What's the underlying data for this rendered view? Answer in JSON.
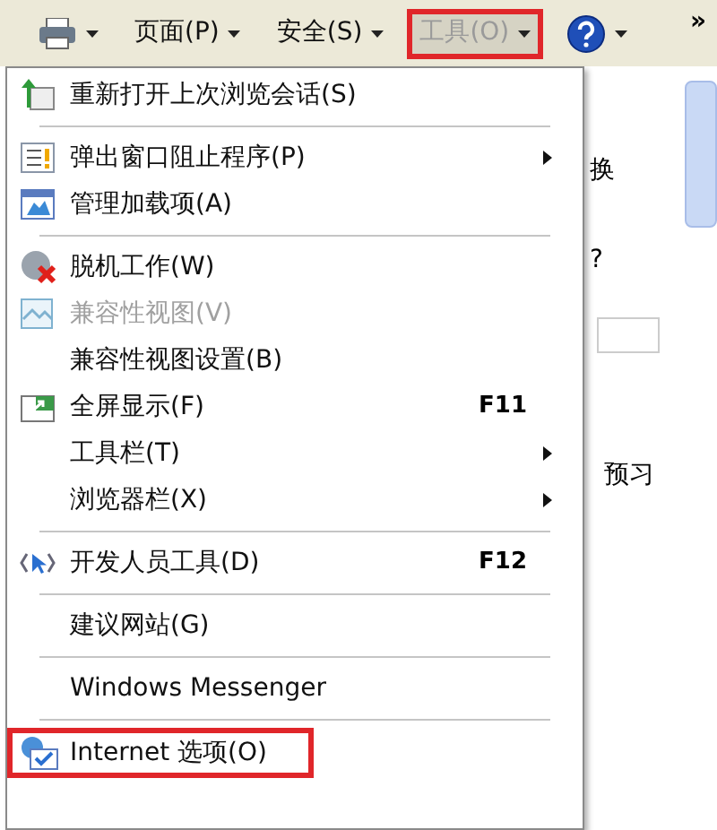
{
  "toolbar": {
    "items": [
      {
        "kind": "icon",
        "dropdown": true,
        "selected": false
      },
      {
        "kind": "text",
        "label": "页面(P)",
        "dropdown": true,
        "selected": false
      },
      {
        "kind": "text",
        "label": "安全(S)",
        "dropdown": true,
        "selected": false
      },
      {
        "kind": "text",
        "label": "工具(O)",
        "dropdown": true,
        "selected": true
      },
      {
        "kind": "help",
        "dropdown": true,
        "selected": false
      }
    ],
    "overflow": "»"
  },
  "page": {
    "texts": [
      "换",
      "?",
      "预习"
    ]
  },
  "menu": {
    "items": [
      {
        "kind": "item",
        "label": "重新打开上次浏览会话(S)",
        "disabled": false,
        "selected": false
      },
      {
        "kind": "separator"
      },
      {
        "kind": "item",
        "label": "弹出窗口阻止程序(P)",
        "submenu": true,
        "disabled": false,
        "selected": false
      },
      {
        "kind": "item",
        "label": "管理加载项(A)",
        "disabled": false,
        "selected": false
      },
      {
        "kind": "separator"
      },
      {
        "kind": "item",
        "label": "脱机工作(W)",
        "disabled": false,
        "selected": false
      },
      {
        "kind": "item",
        "label": "兼容性视图(V)",
        "disabled": true,
        "selected": false
      },
      {
        "kind": "item",
        "label": "兼容性视图设置(B)",
        "disabled": false,
        "selected": false
      },
      {
        "kind": "item",
        "label": "全屏显示(F)",
        "shortcut": "F11",
        "disabled": false,
        "selected": false
      },
      {
        "kind": "item",
        "label": "工具栏(T)",
        "submenu": true,
        "disabled": false,
        "selected": false
      },
      {
        "kind": "item",
        "label": "浏览器栏(X)",
        "submenu": true,
        "disabled": false,
        "selected": false
      },
      {
        "kind": "separator"
      },
      {
        "kind": "item",
        "label": "开发人员工具(D)",
        "shortcut": "F12",
        "disabled": false,
        "selected": false
      },
      {
        "kind": "separator"
      },
      {
        "kind": "item",
        "label": "建议网站(G)",
        "disabled": false,
        "selected": false
      },
      {
        "kind": "separator"
      },
      {
        "kind": "item",
        "label": "Windows Messenger",
        "disabled": false,
        "selected": false
      },
      {
        "kind": "separator"
      },
      {
        "kind": "item",
        "label": "Internet 选项(O)",
        "disabled": false,
        "selected": true
      }
    ]
  }
}
